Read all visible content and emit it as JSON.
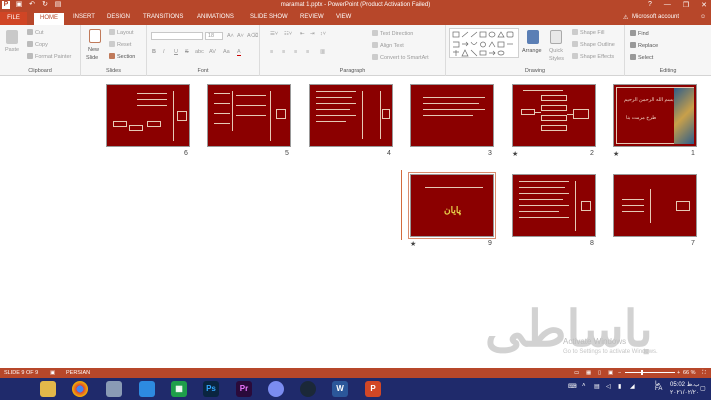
{
  "titlebar": {
    "title": "maramat 1.pptx - PowerPoint (Product Activation Failed)",
    "qat": [
      "save-icon",
      "undo-icon",
      "redo-icon",
      "present-icon"
    ],
    "help": "?",
    "minimize": "—",
    "restore": "❐",
    "close": "✕"
  },
  "tabs": [
    "FILE",
    "HOME",
    "INSERT",
    "DESIGN",
    "TRANSITIONS",
    "ANIMATIONS",
    "SLIDE SHOW",
    "REVIEW",
    "VIEW"
  ],
  "account": "Microsoft account",
  "ribbon": {
    "clipboard": {
      "label": "Clipboard",
      "paste": "Paste",
      "cut": "Cut",
      "copy": "Copy",
      "format_painter": "Format Painter"
    },
    "slides": {
      "label": "Slides",
      "new_slide": "New",
      "new_slide2": "Slide",
      "layout": "Layout",
      "reset": "Reset",
      "section": "Section"
    },
    "font": {
      "label": "Font",
      "size": "18",
      "bold": "B",
      "italic": "I",
      "underline": "U",
      "strike": "S",
      "shadow": "abc",
      "spacing": "AV",
      "case": "Aa",
      "color": "A"
    },
    "paragraph": {
      "label": "Paragraph",
      "text_direction": "Text Direction",
      "align_text": "Align Text",
      "convert_smartart": "Convert to SmartArt"
    },
    "drawing": {
      "label": "Drawing",
      "arrange": "Arrange",
      "quick_styles": "Quick",
      "quick_styles2": "Styles",
      "shape_fill": "Shape Fill",
      "shape_outline": "Shape Outline",
      "shape_effects": "Shape Effects"
    },
    "editing": {
      "label": "Editing",
      "find": "Find",
      "replace": "Replace",
      "select": "Select"
    }
  },
  "slides": [
    {
      "num": "1",
      "star": "★",
      "title": "بسم الله الرحمن الرحيم",
      "subtitle": "طرح مرمت بنا"
    },
    {
      "num": "2",
      "star": "★"
    },
    {
      "num": "3",
      "star": ""
    },
    {
      "num": "4",
      "star": ""
    },
    {
      "num": "5",
      "star": ""
    },
    {
      "num": "6",
      "star": ""
    },
    {
      "num": "7",
      "star": ""
    },
    {
      "num": "8",
      "star": ""
    },
    {
      "num": "9",
      "star": "★",
      "title": "پایان"
    }
  ],
  "watermark": "باساطى",
  "activate": {
    "line1": "Activate Windows",
    "line2": "Go to Settings to activate Windows."
  },
  "statusbar": {
    "slide": "SLIDE 9 OF 9",
    "lang": "PERSIAN",
    "zoom": "66 %"
  },
  "taskbar": {
    "apps": [
      "folder",
      "chrome",
      "drive",
      "store",
      "calculator",
      "photoshop",
      "premiere",
      "chat",
      "steam",
      "word",
      "powerpoint"
    ],
    "lang": "FA",
    "time": "05:02 ب.ظ",
    "date": "۲۰۲۱/۰۲/۲۰",
    "day": "ما"
  },
  "colors": {
    "accent": "#b7472a",
    "slide_bg": "#8b0000",
    "taskbar": "#1f2a6b"
  }
}
